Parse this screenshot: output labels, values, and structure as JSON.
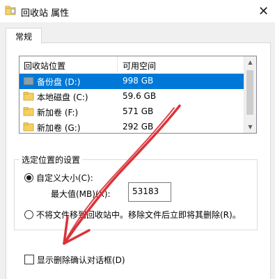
{
  "window": {
    "title": "回收站 属性",
    "close_glyph": "✕"
  },
  "tabs": [
    {
      "label": "常规",
      "active": true
    }
  ],
  "recycle_list": {
    "columns": [
      "回收站位置",
      "可用空间"
    ],
    "rows": [
      {
        "name": "备份盘 (D:)",
        "free": "998 GB",
        "selected": true
      },
      {
        "name": "本地磁盘 (C:)",
        "free": "59.6 GB",
        "selected": false
      },
      {
        "name": "新加卷 (F:)",
        "free": "571 GB",
        "selected": false
      },
      {
        "name": "新加卷 (G:)",
        "free": "292 GB",
        "selected": false
      }
    ]
  },
  "settings": {
    "group_title": "选定位置的设置",
    "custom_size_label": "自定义大小(C):",
    "custom_size_selected": true,
    "max_size_label": "最大值(MB)(X):",
    "max_size_value": "53183",
    "delete_immediately_label": "不将文件移到回收站中。移除文件后立即将其删除(R)。",
    "delete_immediately_selected": false
  },
  "confirm_checkbox": {
    "label": "显示删除确认对话框(D)",
    "checked": false
  },
  "colors": {
    "selection": "#0078d7",
    "annotation_arrow": "#d9333a",
    "folder_yellow": "#f5d061",
    "drive_gray": "#8aa0ad"
  },
  "icons": {
    "title": "recycle-bin-icon",
    "drive_d": "drive-icon",
    "folders": "folder-icon"
  }
}
